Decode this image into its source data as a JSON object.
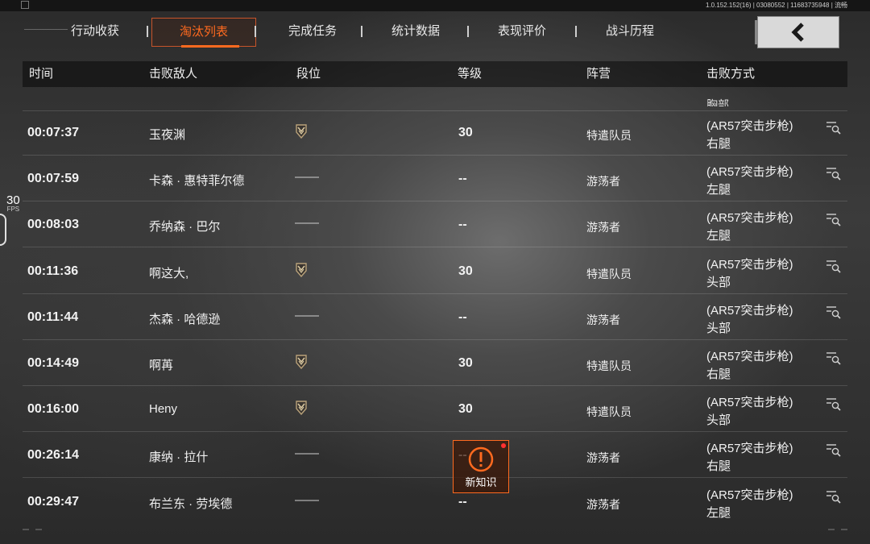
{
  "version": "1.0.152.152(16) | 03080552 | 11683735948 | 流畅",
  "fps": {
    "value": "30",
    "label": "FPS"
  },
  "tabs": [
    {
      "label": "行动收获",
      "active": false
    },
    {
      "label": "淘汰列表",
      "active": true
    },
    {
      "label": "完成任务",
      "active": false
    },
    {
      "label": "统计数据",
      "active": false
    },
    {
      "label": "表现评价",
      "active": false
    },
    {
      "label": "战斗历程",
      "active": false
    }
  ],
  "back_icon": "chevron-left-icon",
  "columns": {
    "time": "时间",
    "enemy": "击败敌人",
    "rank": "段位",
    "level": "等级",
    "camp": "阵营",
    "method": "击败方式"
  },
  "partial_row_text": "胸部",
  "rows": [
    {
      "time": "00:07:37",
      "enemy": "玉夜渊",
      "rank": "rank-badge-icon",
      "rank_text": "",
      "level": "30",
      "camp": "特遣队员",
      "weapon": "(AR57突击步枪)",
      "hit": "右腿"
    },
    {
      "time": "00:07:59",
      "enemy": "卡森 · 惠特菲尔德",
      "rank": "",
      "rank_text": "——",
      "level": "--",
      "camp": "游荡者",
      "weapon": "(AR57突击步枪)",
      "hit": "左腿"
    },
    {
      "time": "00:08:03",
      "enemy": "乔纳森 · 巴尔",
      "rank": "",
      "rank_text": "——",
      "level": "--",
      "camp": "游荡者",
      "weapon": "(AR57突击步枪)",
      "hit": "左腿"
    },
    {
      "time": "00:11:36",
      "enemy": "啊这大,",
      "rank": "rank-badge-icon",
      "rank_text": "",
      "level": "30",
      "camp": "特遣队员",
      "weapon": "(AR57突击步枪)",
      "hit": "头部"
    },
    {
      "time": "00:11:44",
      "enemy": "杰森 · 哈德逊",
      "rank": "",
      "rank_text": "——",
      "level": "--",
      "camp": "游荡者",
      "weapon": "(AR57突击步枪)",
      "hit": "头部"
    },
    {
      "time": "00:14:49",
      "enemy": "啊苒",
      "rank": "rank-badge-icon",
      "rank_text": "",
      "level": "30",
      "camp": "特遣队员",
      "weapon": "(AR57突击步枪)",
      "hit": "右腿"
    },
    {
      "time": "00:16:00",
      "enemy": "Heny",
      "rank": "rank-badge-icon",
      "rank_text": "",
      "level": "30",
      "camp": "特遣队员",
      "weapon": "(AR57突击步枪)",
      "hit": "头部"
    },
    {
      "time": "00:26:14",
      "enemy": "康纳 · 拉什",
      "rank": "",
      "rank_text": "——",
      "level": "--",
      "camp": "游荡者",
      "weapon": "(AR57突击步枪)",
      "hit": "右腿"
    },
    {
      "time": "00:29:47",
      "enemy": "布兰东 · 劳埃德",
      "rank": "",
      "rank_text": "——",
      "level": "--",
      "camp": "游荡者",
      "weapon": "(AR57突击步枪)",
      "hit": "左腿"
    }
  ],
  "notification": {
    "label": "新知识",
    "icon": "alert-icon"
  },
  "colors": {
    "accent": "#ff6a1f",
    "alert_dot": "#ff3030"
  }
}
